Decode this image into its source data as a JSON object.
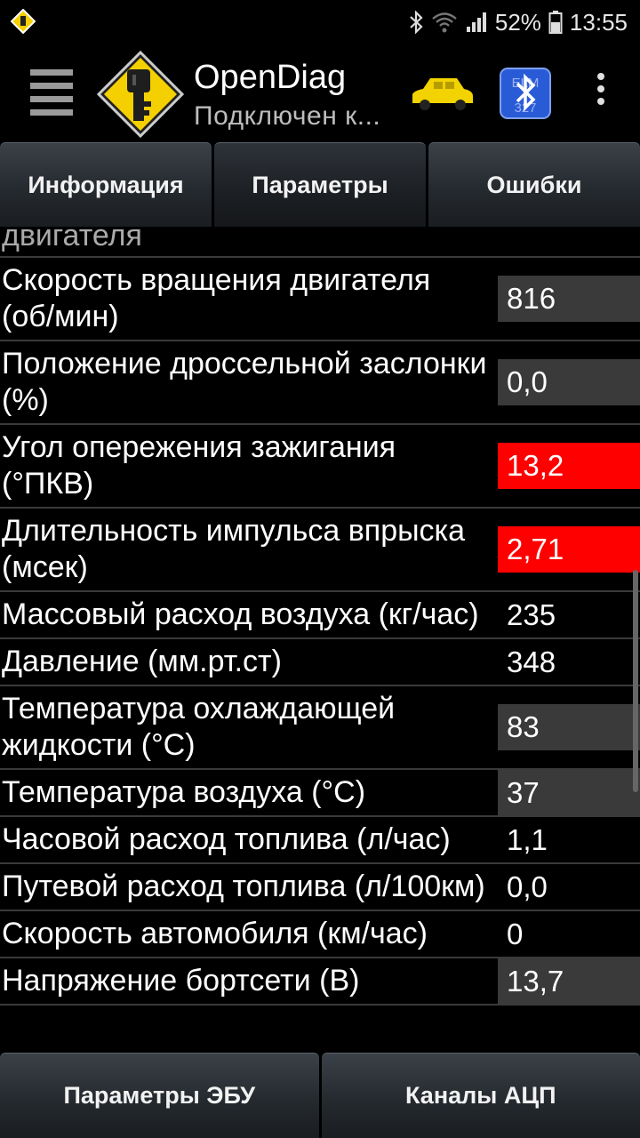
{
  "status_bar": {
    "battery": "52%",
    "time": "13:55",
    "icons": [
      "bluetooth-icon",
      "wifi-icon",
      "signal-icon",
      "battery-icon"
    ]
  },
  "toolbar": {
    "title": "OpenDiag",
    "subtitle": "Подключен к...",
    "icons": [
      "menu-icon",
      "app-logo-key-icon",
      "car-icon",
      "bluetooth-elm327-icon",
      "overflow-menu-icon"
    ]
  },
  "tabs": [
    {
      "label": "Информация"
    },
    {
      "label": "Параметры"
    },
    {
      "label": "Ошибки"
    }
  ],
  "parameters": [
    {
      "label": "двигателя",
      "value": ""
    },
    {
      "label": "Скорость вращения двигателя (об/мин)",
      "value": "816"
    },
    {
      "label": "Положение дроссельной заслонки (%)",
      "value": "0,0"
    },
    {
      "label": "Угол опережения зажигания (°ПКВ)",
      "value": "13,2"
    },
    {
      "label": "Длительность импульса впрыска (мсек)",
      "value": "2,71"
    },
    {
      "label": "Массовый расход воздуха (кг/час)",
      "value": "235"
    },
    {
      "label": "Давление (мм.рт.ст)",
      "value": "348"
    },
    {
      "label": "Температура охлаждающей жидкости (°C)",
      "value": "83"
    },
    {
      "label": "Температура воздуха (°C)",
      "value": "37"
    },
    {
      "label": "Часовой расход топлива (л/час)",
      "value": "1,1"
    },
    {
      "label": "Путевой расход топлива (л/100км)",
      "value": "0,0"
    },
    {
      "label": "Скорость автомобиля (км/час)",
      "value": "0"
    },
    {
      "label": "Напряжение бортсети (В)",
      "value": "13,7"
    }
  ],
  "bottom_buttons": [
    {
      "label": "Параметры ЭБУ"
    },
    {
      "label": "Каналы АЦП"
    }
  ],
  "colors": {
    "alert": "#ff0000",
    "value_bg": "#3a3a3a",
    "logo_yellow": "#f5d000",
    "car_yellow": "#f2d200",
    "bt_blue": "#2a5bd7"
  }
}
